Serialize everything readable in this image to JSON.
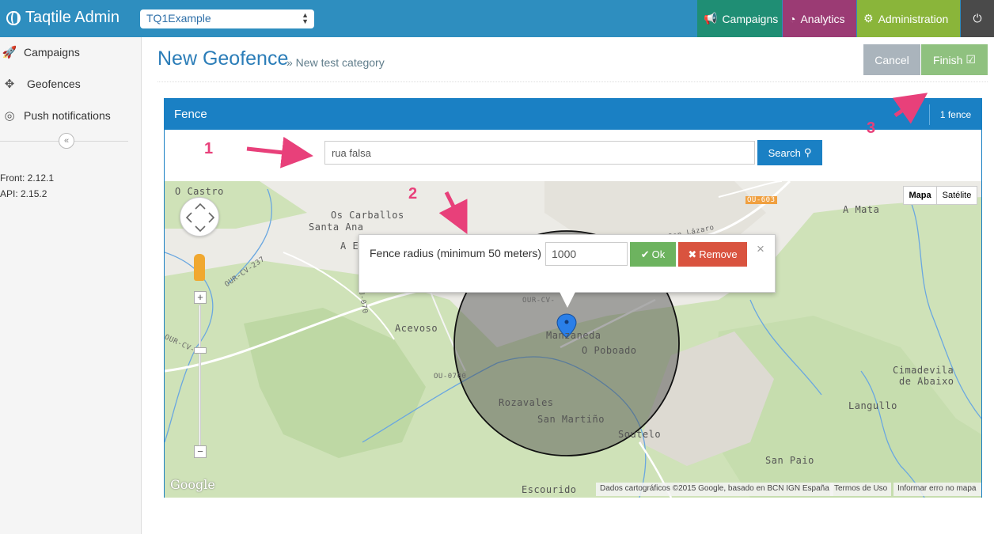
{
  "topbar": {
    "brand": "Taqtile Admin",
    "app_selected": "TQ1Example",
    "nav": {
      "campaigns": "Campaigns",
      "analytics": "Analytics",
      "administration": "Administration"
    },
    "colors": {
      "bar": "#2e8ebf",
      "campaigns": "#1f8e74",
      "analytics": "#9b3b74",
      "administration": "#8ab53a",
      "power": "#4a4a4a"
    }
  },
  "sidebar": {
    "items": [
      {
        "label": "Campaigns",
        "icon": "rocket-icon"
      },
      {
        "label": "Geofences",
        "icon": "crosshair-icon"
      },
      {
        "label": "Push notifications",
        "icon": "target-icon"
      }
    ],
    "front_version": "Front: 2.12.1",
    "api_version": "API: 2.15.2"
  },
  "header": {
    "title": "New Geofence",
    "breadcrumb": "» New test category",
    "cancel": "Cancel",
    "finish": "Finish"
  },
  "panel": {
    "title": "Fence",
    "count": "1 fence",
    "search_value": "rua falsa",
    "search_button": "Search"
  },
  "map": {
    "type_map": "Mapa",
    "type_satellite": "Satélite",
    "labels": {
      "o_castro": "O Castro",
      "os_carballos": "Os Carballos",
      "santa_ana": "Santa Ana",
      "a_e": "A E",
      "acevoso": "Acevoso",
      "manzaneda": "Manzaneda",
      "o_poboado": "O Poboado",
      "rozavales": "Rozavales",
      "san_martino": "San Martiño",
      "soutelo": "Soutelo",
      "escourido": "Escourido",
      "a_mata": "A Mata",
      "cimadevila": "Cimadevila",
      "de_abaixo": "de Abaixo",
      "langullo": "Langullo",
      "san_paio": "San Paio",
      "san_lazaro": "San Lázaro",
      "ou_603": "OU-603",
      "our_cv_237": "OUR-CV-237",
      "our_cv": "OUR-CV-",
      "ou_070": "OU-0700",
      "our_cv_2": "OUR-CV-2",
      "ou_070b": "OU-070"
    },
    "google": "Google",
    "attribution": "Dados cartográficos ©2015 Google, basado en BCN IGN España",
    "terms": "Termos de Uso",
    "report": "Informar erro no mapa"
  },
  "popup": {
    "radius_label": "Fence radius (minimum 50 meters)",
    "radius_value": "1000",
    "ok": "Ok",
    "remove": "Remove",
    "close": "×"
  },
  "annotations": [
    "1",
    "2",
    "3"
  ]
}
